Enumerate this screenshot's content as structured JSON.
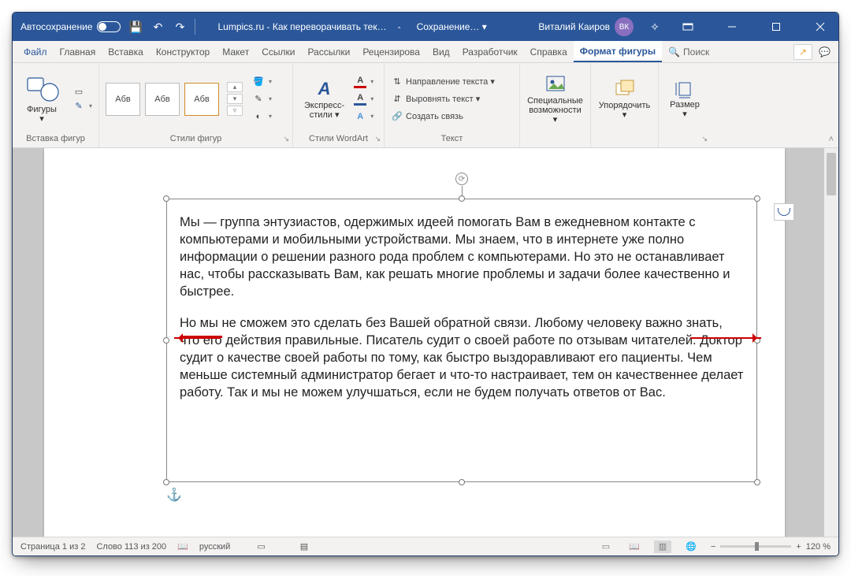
{
  "titlebar": {
    "autosave": "Автосохранение",
    "doc": "Lumpics.ru - Как переворачивать тек…",
    "saving": "Сохранение… ▾",
    "user": "Виталий Каиров",
    "initials": "ВК"
  },
  "tabs": {
    "file": "Файл",
    "items": [
      "Главная",
      "Вставка",
      "Конструктор",
      "Макет",
      "Ссылки",
      "Рассылки",
      "Рецензирова",
      "Вид",
      "Разработчик",
      "Справка"
    ],
    "active": "Формат фигуры",
    "search": "Поиск"
  },
  "ribbon": {
    "insert_shapes": {
      "label": "Вставка фигур",
      "shapes": "Фигуры ▾"
    },
    "shape_styles": {
      "label": "Стили фигур",
      "preset": "Абв"
    },
    "wordart": {
      "label": "Стили WordArt",
      "express": "Экспресс-\nстили ▾",
      "A": "A"
    },
    "text": {
      "label": "Текст",
      "dir": "Направление текста ▾",
      "align": "Выровнять текст ▾",
      "link": "Создать связь"
    },
    "acc": {
      "label": "",
      "alt": "Специальные\nвозможности ▾"
    },
    "arrange": {
      "label": "",
      "btn": "Упорядочить\n▾"
    },
    "size": {
      "label": "",
      "btn": "Размер\n▾"
    }
  },
  "body": {
    "p1": "Мы — группа энтузиастов, одержимых идеей помогать Вам в ежедневном контакте с компьютерами и мобильными устройствами. Мы знаем, что в интернете уже полно информации о решении разного рода проблем с компьютерами. Но это не останавливает нас, чтобы рассказывать Вам, как решать многие проблемы и задачи более качественно и быстрее.",
    "p2": "Но мы не сможем это сделать без Вашей обратной связи. Любому человеку важно знать, что его действия правильные. Писатель судит о своей работе по отзывам читателей. Доктор судит о качестве своей работы по тому, как быстро выздоравливают его пациенты. Чем меньше системный администратор бегает и что-то настраивает, тем он качественнее делает работу. Так и мы не можем улучшаться, если не будем получать ответов от Вас."
  },
  "status": {
    "page": "Страница 1 из 2",
    "words": "Слово 113 из 200",
    "lang": "русский",
    "zoom": "120 %"
  }
}
